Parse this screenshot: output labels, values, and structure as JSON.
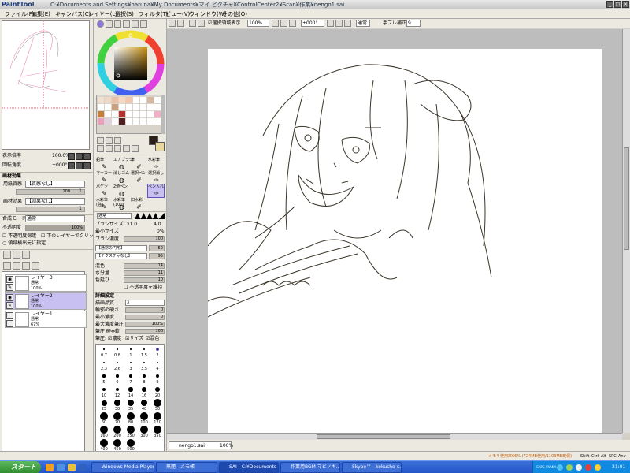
{
  "window": {
    "app_logo": "PaintTool SAI",
    "title": "C:¥Documents and Settings¥haruna¥My Documents¥マイ ピクチャ¥ControlCenter2¥Scan¥作業¥nengo1.sai",
    "min": "_",
    "max": "□",
    "close": "×"
  },
  "menu": [
    "ファイル(F)",
    "編集(E)",
    "キャンバス(C)",
    "レイヤー(L)",
    "選択(S)",
    "フィルタ(T)",
    "ビュー(V)",
    "ウィンドウ(W)",
    "その他(O)"
  ],
  "navigator": {
    "zoom_label": "表示倍率",
    "zoom_value": "100.0%",
    "rot_label": "回転角度",
    "rot_value": "+000°"
  },
  "paper": {
    "header": "画材効果",
    "texture_label": "用紙質感",
    "texture_value": "【質感なし】",
    "texture_num": "100",
    "texture_num2": "1",
    "effect_label": "画材効果",
    "effect_value": "【効果なし】",
    "effect_num": "1"
  },
  "blend": {
    "mode_label": "合成モード",
    "mode_value": "通常",
    "opacity_label": "不透明度",
    "opacity_value": "100%",
    "opacity_fill": 1.0,
    "protect": "不透明度保護",
    "clip": "下のレイヤーでクリッピング",
    "sel": "領域検出元に指定"
  },
  "layers": [
    {
      "name": "レイヤー3",
      "mode": "通常",
      "opacity": "100%",
      "selected": false
    },
    {
      "name": "レイヤー2",
      "mode": "通常",
      "opacity": "100%",
      "selected": true
    },
    {
      "name": "レイヤー1",
      "mode": "通常",
      "opacity": "67%",
      "selected": false
    }
  ],
  "tools": {
    "row1": [
      "鉛筆",
      "エアブラシ",
      "筆",
      "水彩筆"
    ],
    "row2": [
      "マーカー",
      "消しゴム",
      "選択ペン",
      "選択消し"
    ],
    "row3": [
      "バケツ",
      "2値ペン",
      "",
      "ペン入れ"
    ],
    "row4": [
      "水彩筆",
      "水彩筆",
      "旧水彩",
      ""
    ],
    "row4b": [
      "(強)",
      "(100)",
      "",
      ""
    ],
    "pen_active": "ペン入れ"
  },
  "brush": {
    "mode_value": "通常",
    "size_label": "ブラシサイズ",
    "size_mult": "x1.0",
    "size_value": "4.0",
    "min_label": "最小サイズ",
    "min_value": "0%",
    "density_label": "ブラシ濃度",
    "density_value": "100",
    "shape_value": "【通常の円形】",
    "shape_num": "50",
    "texture_value": "【テクスチャなし】",
    "texture_num": "95",
    "blend_label": "混色",
    "blend_value": "14",
    "water_label": "水分量",
    "water_value": "11",
    "stretch_label": "色延び",
    "stretch_value": "10",
    "keep_opacity": "不透明度を維持",
    "detail_header": "詳細設定",
    "quality_label": "描画品質",
    "quality_value": "3",
    "edge_label": "輪郭の硬さ",
    "edge_value": "0",
    "min_density_label": "最小濃度",
    "min_density_value": "0",
    "max_pressure_label": "最大濃度筆圧",
    "max_pressure_value": "100%",
    "pressure_hard_label": "筆圧 硬⇔軟",
    "pressure_hard_value": "100",
    "pressure_label": "筆圧:",
    "pressure_density": "濃度",
    "pressure_size": "サイズ",
    "pressure_blend": "混色"
  },
  "dot_rows": [
    [
      "0.7",
      "0.8",
      "1",
      "1.5",
      "2"
    ],
    [
      "2.3",
      "2.6",
      "3",
      "3.5",
      "4"
    ],
    [
      "5",
      "6",
      "7",
      "8",
      "9"
    ],
    [
      "10",
      "12",
      "14",
      "16",
      "20"
    ],
    [
      "25",
      "30",
      "35",
      "40",
      "50"
    ],
    [
      "60",
      "70",
      "80",
      "100",
      "120"
    ],
    [
      "160",
      "200",
      "250",
      "300",
      "350"
    ],
    [
      "400",
      "450",
      "500",
      "",
      ""
    ]
  ],
  "canvas_toolbar": {
    "sel_display": "選択領域表示",
    "zoom": "100%",
    "rot": "+000°",
    "mode": "通常",
    "stab_label": "手ブレ補正",
    "stab_value": "9"
  },
  "canvas_tab": {
    "name": "nengo1.sai",
    "zoom": "100%"
  },
  "status": {
    "memory": "メモリ使用率66% (724MB使用/1103MB確保)",
    "keys": [
      "Shift",
      "Ctrl",
      "Alt",
      "SPC",
      "Any"
    ]
  },
  "taskbar": {
    "start": "スタート",
    "items": [
      "Windows Media Player",
      "無題 - メモ帳",
      "SAI - C:¥Documents ...",
      "作業用BGM マビノギ...",
      "Skype™ - kokusho-s..."
    ],
    "time": "21:01",
    "tray_text": "CAPS / KANA"
  },
  "colors": {
    "accent": "#3a6fd8",
    "selected_layer": "#c8c0f0",
    "primary": "#2a2018",
    "secondary": "#e8d8a0"
  },
  "swatches": [
    "#f0e0d0",
    "#f0d8c8",
    "#e8c0a8",
    "#f8d8c0",
    "#f0c8b0",
    "#fff",
    "#fff",
    "#d8b8a0",
    "#fff",
    "#fff",
    "#fff",
    "#c8a080",
    "#fff",
    "#fff",
    "#fff",
    "#fff",
    "#fff",
    "#fff",
    "#c08040",
    "#fff",
    "#fff",
    "#b83030",
    "#fff",
    "#fff",
    "#fff",
    "#fff",
    "#f0b0c8",
    "#e8a0b8",
    "#e0d0e0",
    "#fff",
    "#502020",
    "#fff",
    "#fff",
    "#fff",
    "#fff",
    "#fff"
  ]
}
